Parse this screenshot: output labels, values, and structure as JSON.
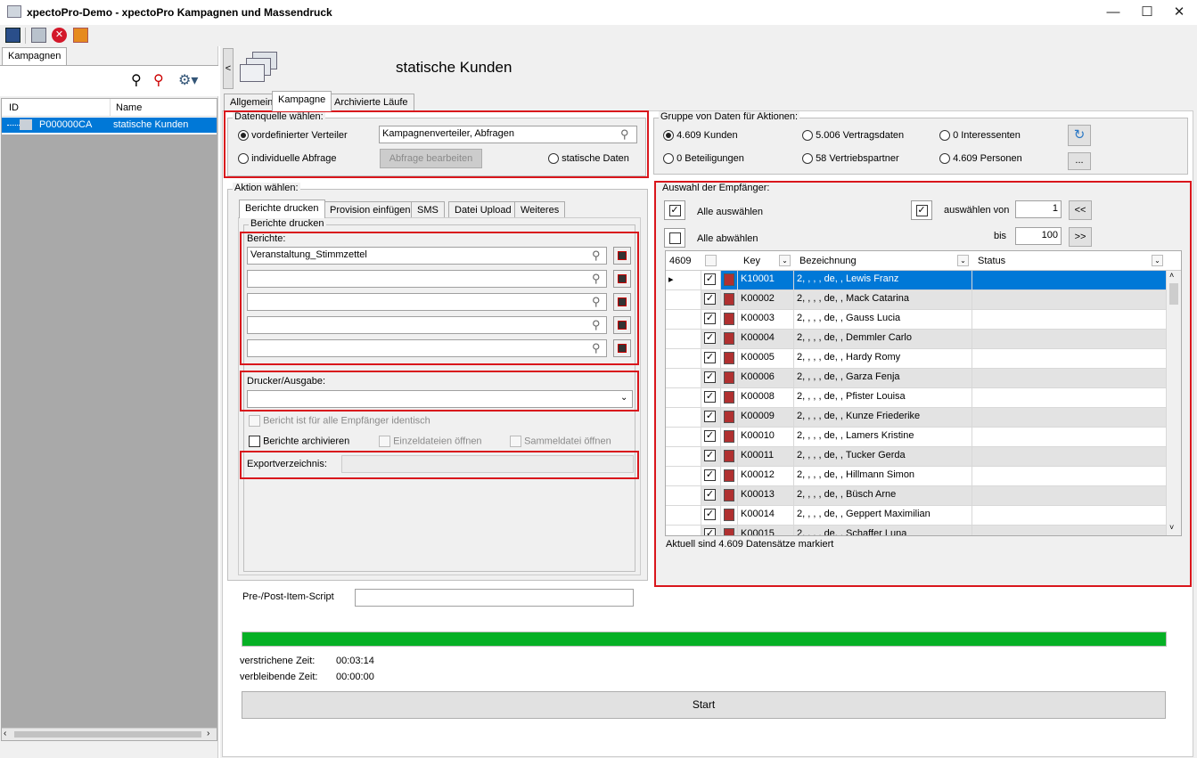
{
  "window": {
    "title": "xpectoPro-Demo - xpectoPro Kampagnen und Massendruck",
    "min": "—",
    "max": "☐",
    "close": "✕"
  },
  "left": {
    "tab": "Kampagnen",
    "col_id": "ID",
    "col_name": "Name",
    "row": {
      "id": "P000000CA",
      "name": "statische Kunden"
    }
  },
  "header": {
    "title": "statische Kunden",
    "collapse": "<"
  },
  "tabs": [
    "Allgemein",
    "Kampagne",
    "Archivierte Läufe"
  ],
  "datenquelle": {
    "legend": "Datenquelle wählen:",
    "opt1": "vordefinierter Verteiler",
    "opt1_value": "Kampagnenverteiler, Abfragen",
    "opt2": "individuelle Abfrage",
    "edit_btn": "Abfrage bearbeiten",
    "opt3": "statische Daten"
  },
  "gruppe": {
    "legend": "Gruppe von Daten für Aktionen:",
    "items": [
      "4.609 Kunden",
      "5.006 Vertragsdaten",
      "0 Interessenten",
      "0 Beteiligungen",
      "58 Vertriebspartner",
      "4.609 Personen"
    ],
    "more": "..."
  },
  "aktion": {
    "legend": "Aktion wählen:",
    "tabs": [
      "Berichte drucken",
      "Provision einfügen",
      "SMS",
      "Datei Upload",
      "Weiteres"
    ],
    "group": "Berichte drucken",
    "berichte_label": "Berichte:",
    "berichte": [
      "Veranstaltung_Stimmzettel",
      "",
      "",
      "",
      ""
    ],
    "drucker_label": "Drucker/Ausgabe:",
    "drucker_value": "",
    "identisch": "Bericht ist für alle Empfänger identisch",
    "archivieren": "Berichte archivieren",
    "einzel": "Einzeldateien öffnen",
    "sammel": "Sammeldatei öffnen",
    "export_label": "Exportverzeichnis:"
  },
  "empfaenger": {
    "legend": "Auswahl der Empfänger:",
    "alle_ausw": "Alle auswählen",
    "alle_abw": "Alle abwählen",
    "ausw_von": "auswählen von",
    "von": "1",
    "bis_label": "bis",
    "bis": "100",
    "prev": "<<",
    "next": ">>",
    "count": "4609",
    "col_key": "Key",
    "col_bez": "Bezeichnung",
    "col_status": "Status",
    "rows": [
      [
        "K10001",
        "2, , , , de, , Lewis Franz"
      ],
      [
        "K00002",
        "2, , , , de, , Mack Catarina"
      ],
      [
        "K00003",
        "2, , , , de, , Gauss Lucia"
      ],
      [
        "K00004",
        "2, , , , de, , Demmler Carlo"
      ],
      [
        "K00005",
        "2, , , , de, , Hardy Romy"
      ],
      [
        "K00006",
        "2, , , , de, , Garza Fenja"
      ],
      [
        "K00008",
        "2, , , , de, , Pfister Louisa"
      ],
      [
        "K00009",
        "2, , , , de, , Kunze Friederike"
      ],
      [
        "K00010",
        "2, , , , de, , Lamers Kristine"
      ],
      [
        "K00011",
        "2, , , , de, , Tucker Gerda"
      ],
      [
        "K00012",
        "2, , , , de, , Hillmann Simon"
      ],
      [
        "K00013",
        "2, , , , de, , Büsch Arne"
      ],
      [
        "K00014",
        "2, , , , de, , Geppert Maximilian"
      ],
      [
        "K00015",
        "2, , , , de, , Schaffer Luna"
      ]
    ],
    "status": "Aktuell sind 4.609 Datensätze markiert"
  },
  "script": {
    "label": "Pre-/Post-Item-Script",
    "value": ""
  },
  "progress": {
    "value": 1.0,
    "color": "#06b025"
  },
  "times": {
    "elapsed_label": "verstrichene Zeit:",
    "elapsed": "00:03:14",
    "remaining_label": "verbleibende Zeit:",
    "remaining": "00:00:00"
  },
  "start": "Start"
}
